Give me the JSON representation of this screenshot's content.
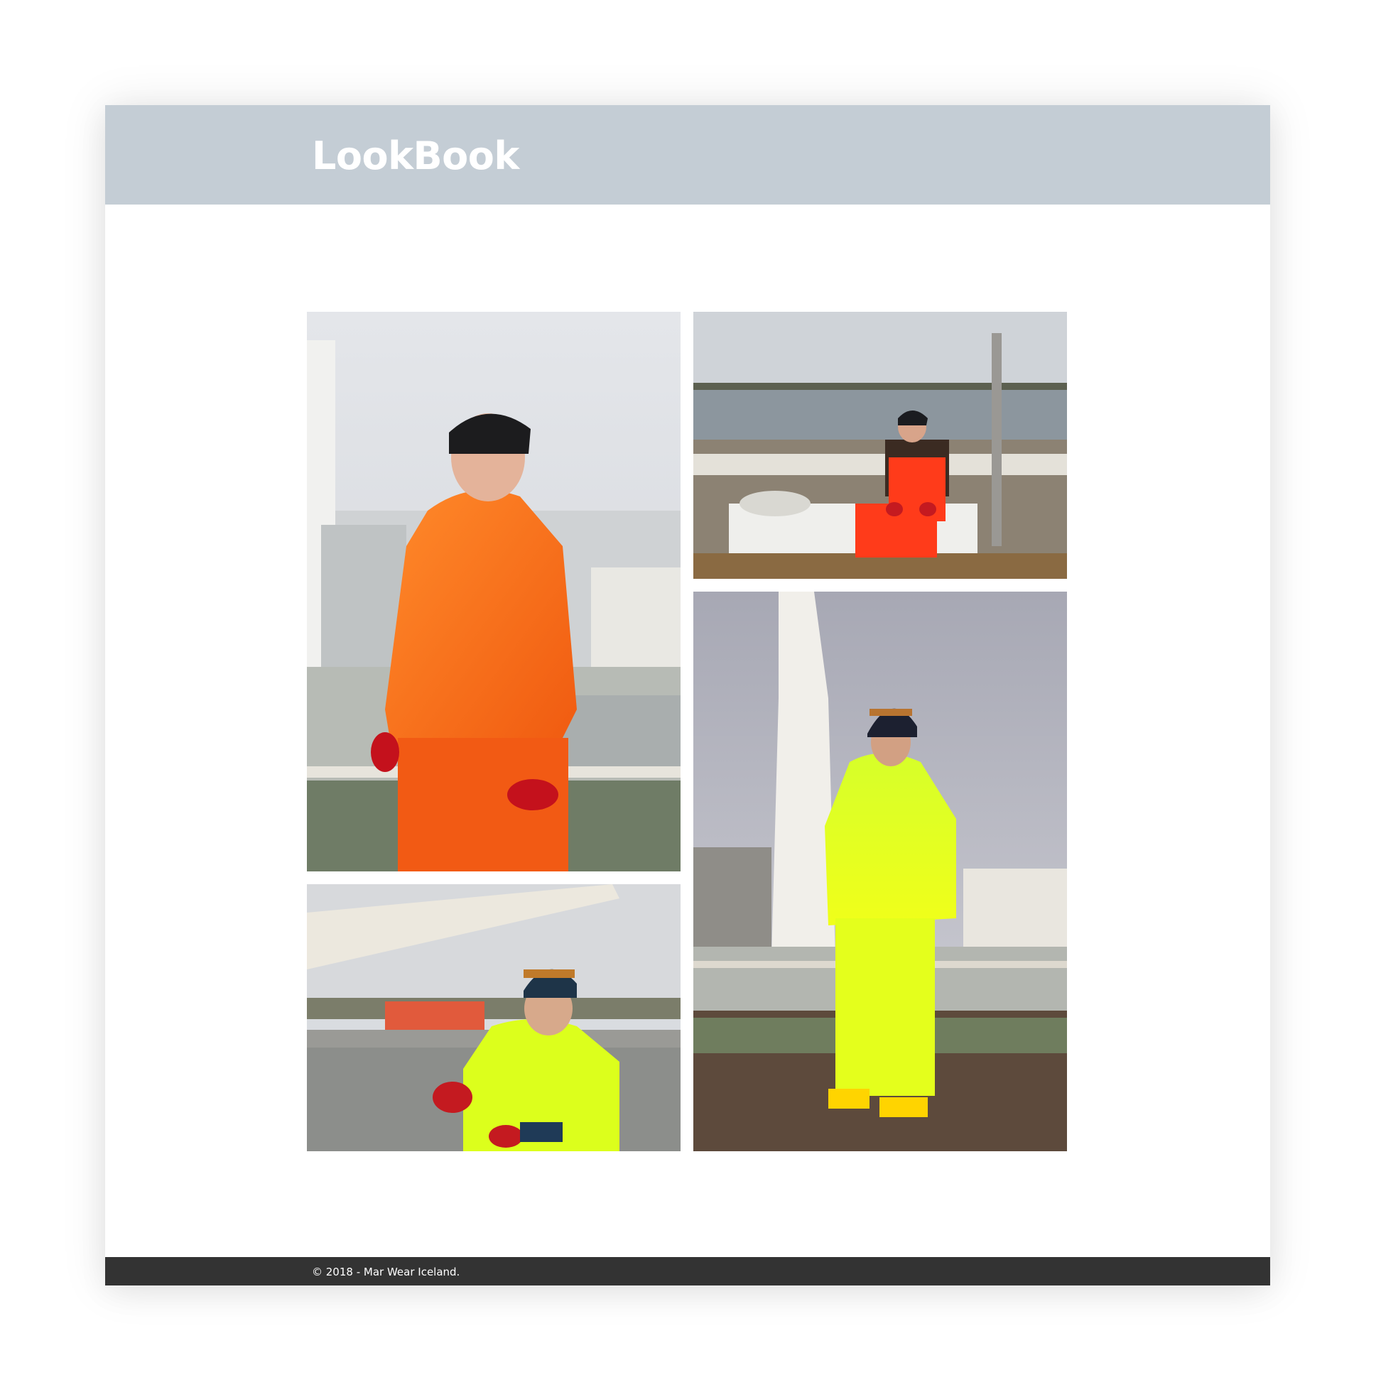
{
  "header": {
    "title": "LookBook",
    "background_color": "#c4cdd5"
  },
  "gallery": {
    "photos": [
      {
        "id": "photo-orange-jacket",
        "subject": "man in orange rain jacket and black beanie on ship deck",
        "accent": "#ff6a1a"
      },
      {
        "id": "photo-seated-sweater",
        "subject": "man in Icelandic sweater and orange overalls seated on deck hatch",
        "accent": "#ff3b1a"
      },
      {
        "id": "photo-yellow-gloves",
        "subject": "bearded man in neon yellow jacket pulling on red gloves at harbor",
        "accent": "#d9ff1a"
      },
      {
        "id": "photo-yellow-full",
        "subject": "bearded man in full neon yellow rain suit standing on deck",
        "accent": "#d9ff1a"
      }
    ]
  },
  "footer": {
    "copyright": "© 2018 - Mar Wear Iceland.",
    "background_color": "#333333"
  }
}
